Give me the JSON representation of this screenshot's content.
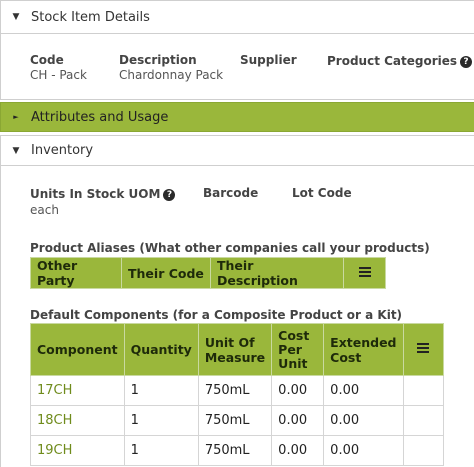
{
  "sections": {
    "stock_item": "Stock Item Details",
    "attributes": "Attributes and Usage",
    "inventory": "Inventory"
  },
  "details": {
    "code_label": "Code",
    "code_value": "CH - Pack",
    "description_label": "Description",
    "description_value": "Chardonnay Pack",
    "supplier_label": "Supplier",
    "categories_label": "Product Categories"
  },
  "inventory": {
    "uom_label": "Units In Stock UOM",
    "uom_value": "each",
    "barcode_label": "Barcode",
    "lot_label": "Lot Code",
    "aliases_heading": "Product Aliases (What other companies call your products)",
    "aliases_columns": [
      "Other Party",
      "Their Code",
      "Their Description"
    ],
    "components_heading": "Default Components (for a Composite Product or a Kit)",
    "components_columns": {
      "component": "Component",
      "quantity": "Quantity",
      "uom_line1": "Unit Of",
      "uom_line2": "Measure",
      "cost_line1": "Cost",
      "cost_line2": "Per",
      "cost_line3": "Unit",
      "ext_line1": "Extended",
      "ext_line2": "Cost"
    },
    "components_rows": [
      {
        "component": "17CH",
        "quantity": "1",
        "uom": "750mL",
        "cost": "0.00",
        "extended": "0.00"
      },
      {
        "component": "18CH",
        "quantity": "1",
        "uom": "750mL",
        "cost": "0.00",
        "extended": "0.00"
      },
      {
        "component": "19CH",
        "quantity": "1",
        "uom": "750mL",
        "cost": "0.00",
        "extended": "0.00"
      }
    ]
  },
  "icons": {
    "caret_down": "▼",
    "caret_right": "►",
    "help": "?"
  }
}
